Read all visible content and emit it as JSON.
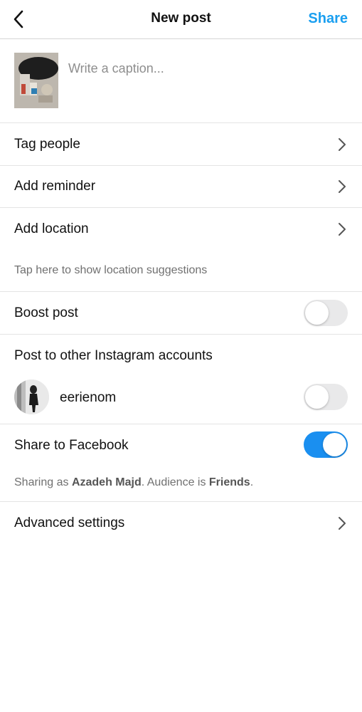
{
  "header": {
    "title": "New post",
    "share_label": "Share",
    "accent_color": "#1a9ff0"
  },
  "caption": {
    "placeholder": "Write a caption...",
    "value": ""
  },
  "options": {
    "tag_people": "Tag people",
    "add_reminder": "Add reminder",
    "add_location": "Add location",
    "location_hint": "Tap here to show location suggestions",
    "boost_post": "Boost post",
    "boost_post_enabled": false
  },
  "other_accounts": {
    "heading": "Post to other Instagram accounts",
    "accounts": [
      {
        "username": "eerienom",
        "enabled": false
      }
    ]
  },
  "facebook": {
    "label": "Share to Facebook",
    "enabled": true,
    "sharing_prefix": "Sharing as ",
    "user_name": "Azadeh Majd",
    "audience_prefix": ". Audience is ",
    "audience": "Friends",
    "suffix": "."
  },
  "advanced": {
    "label": "Advanced settings"
  },
  "icons": {
    "back": "chevron-left-icon",
    "row_chevron": "chevron-right-icon"
  }
}
